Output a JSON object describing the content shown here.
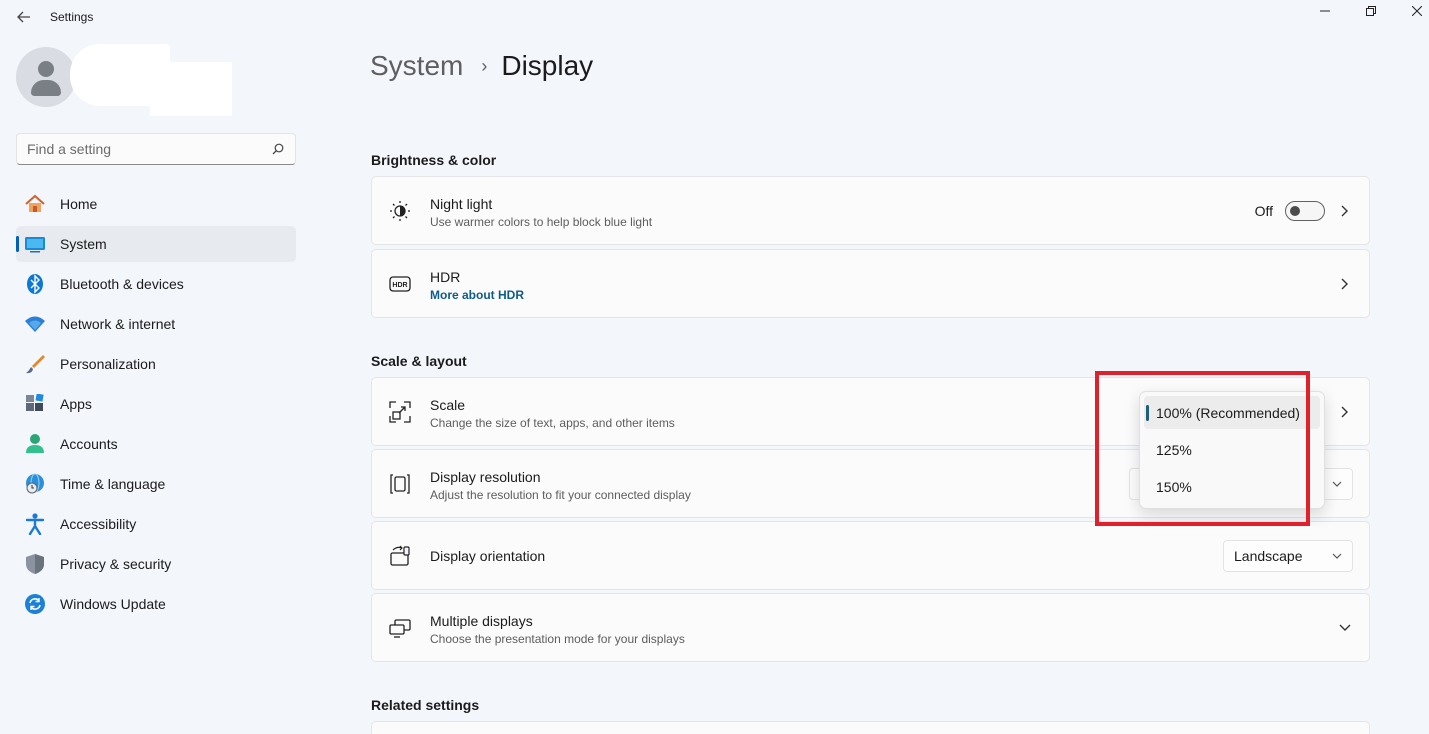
{
  "window": {
    "title": "Settings",
    "back_icon": "back-arrow-icon",
    "controls": [
      "minimize-icon",
      "maximize-icon",
      "close-icon"
    ]
  },
  "search": {
    "placeholder": "Find a setting",
    "icon": "search-icon"
  },
  "sidebar": {
    "items": [
      {
        "label": "Home",
        "icon": "home-icon"
      },
      {
        "label": "System",
        "icon": "system-icon",
        "active": true
      },
      {
        "label": "Bluetooth & devices",
        "icon": "bluetooth-icon"
      },
      {
        "label": "Network & internet",
        "icon": "wifi-icon"
      },
      {
        "label": "Personalization",
        "icon": "brush-icon"
      },
      {
        "label": "Apps",
        "icon": "apps-icon"
      },
      {
        "label": "Accounts",
        "icon": "person-icon"
      },
      {
        "label": "Time & language",
        "icon": "globe-clock-icon"
      },
      {
        "label": "Accessibility",
        "icon": "accessibility-icon"
      },
      {
        "label": "Privacy & security",
        "icon": "shield-icon"
      },
      {
        "label": "Windows Update",
        "icon": "update-icon"
      }
    ]
  },
  "breadcrumb": {
    "parent": "System",
    "separator": "›",
    "current": "Display"
  },
  "sections": {
    "brightness": {
      "title": "Brightness & color",
      "night_light": {
        "title": "Night light",
        "subtitle": "Use warmer colors to help block blue light",
        "toggle_state": "Off",
        "icon": "night-light-icon"
      },
      "hdr": {
        "title": "HDR",
        "link": "More about HDR",
        "icon": "hdr-icon"
      }
    },
    "scale_layout": {
      "title": "Scale & layout",
      "scale": {
        "title": "Scale",
        "subtitle": "Change the size of text, apps, and other items",
        "icon": "scale-icon",
        "options": [
          "100% (Recommended)",
          "125%",
          "150%"
        ],
        "selected": "100% (Recommended)"
      },
      "resolution": {
        "title": "Display resolution",
        "subtitle": "Adjust the resolution to fit your connected display",
        "icon": "resolution-icon"
      },
      "orientation": {
        "title": "Display orientation",
        "value": "Landscape",
        "icon": "orientation-icon"
      },
      "multiple": {
        "title": "Multiple displays",
        "subtitle": "Choose the presentation mode for your displays",
        "icon": "multiple-displays-icon"
      }
    },
    "related": {
      "title": "Related settings"
    }
  },
  "colors": {
    "accent": "#005fb8",
    "annotation": "#e0202a",
    "background": "#f3f6fb"
  }
}
